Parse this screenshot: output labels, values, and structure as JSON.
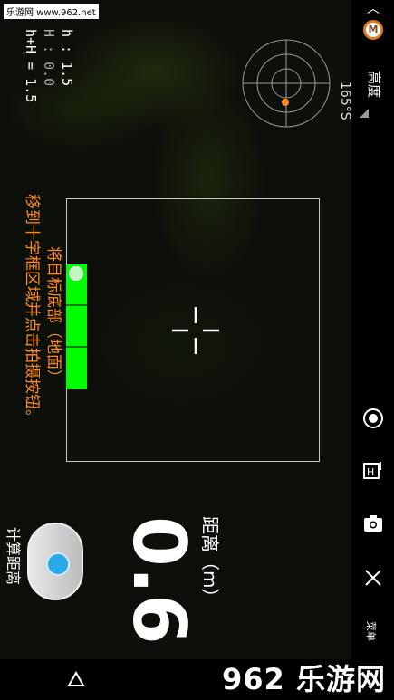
{
  "watermark": "乐游网 www.962.net",
  "hud": {
    "h_line": "h : 1.5",
    "H_line": "H : 0.0",
    "sum_line": "h+H = 1.5"
  },
  "compass": {
    "heading": "165°S"
  },
  "sidebar": {
    "mode_label": "高度",
    "menu_label": "菜单"
  },
  "instructions": {
    "line1": "移到十字框区域并点击拍摄按钮。",
    "line2": "将目标底部（地面）"
  },
  "measure_button_label": "计算距离",
  "result": {
    "label": "距离（m）",
    "value": "0.6"
  },
  "bottom_watermark": "962 乐游网",
  "colors": {
    "accent_orange": "#ff8a1a",
    "level_green": "#00ff00",
    "shutter_blue": "#29a8e8"
  }
}
